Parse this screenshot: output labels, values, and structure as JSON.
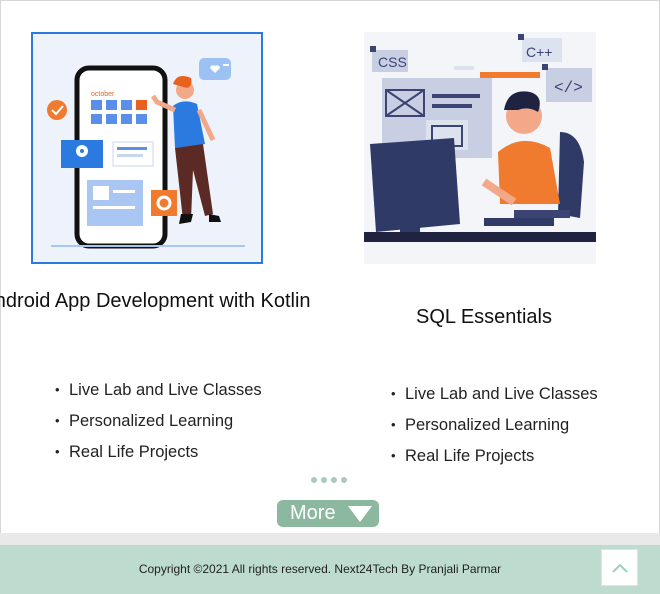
{
  "courses": [
    {
      "title": "Android App Development with Kotlin",
      "image_text": "october",
      "features": [
        "Live Lab and Live Classes",
        "Personalized Learning",
        "Real Life Projects"
      ]
    },
    {
      "title": "SQL Essentials",
      "image_tags": [
        "CSS",
        "C++"
      ],
      "features": [
        "Live Lab and Live Classes",
        "Personalized Learning",
        "Real Life Projects"
      ]
    }
  ],
  "more_button": {
    "label": "More"
  },
  "footer": {
    "copyright": "Copyright ©2021 All rights reserved. Next24Tech By Pranjali Parmar"
  },
  "icons": {
    "more": "chevron-down-icon",
    "scroll_top": "chevron-up-icon"
  },
  "colors": {
    "accent_blue": "#2b7ae0",
    "more_button": "#8bb89e",
    "footer_bg": "#bddbcf"
  }
}
